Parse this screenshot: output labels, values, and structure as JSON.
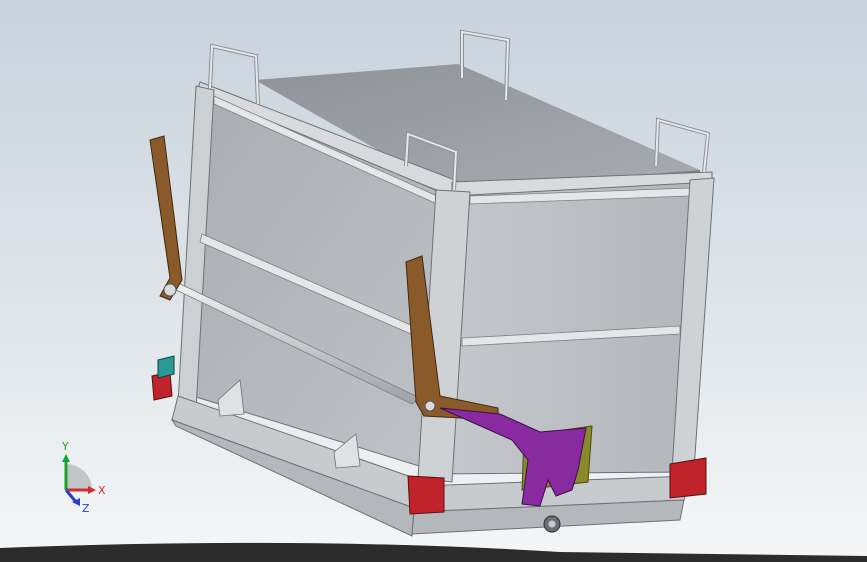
{
  "viewport": {
    "background_top": "#c9d2dc",
    "background_bottom": "#f5f6f7"
  },
  "model": {
    "frame_color": "#c4c6c9",
    "panel_color": "#b8bcc2",
    "arm_color": "#8a5a2a",
    "bracket_color": "#8a2aa0",
    "corner_color": "#c0232b",
    "accent_teal": "#2a9a96",
    "plate_olive": "#8a8a2a"
  },
  "triad": {
    "y_label": "Y",
    "x_label": "X",
    "z_label": "Z",
    "y_color": "#17a329",
    "x_color": "#d22c2c",
    "z_color": "#2a3fd2"
  }
}
